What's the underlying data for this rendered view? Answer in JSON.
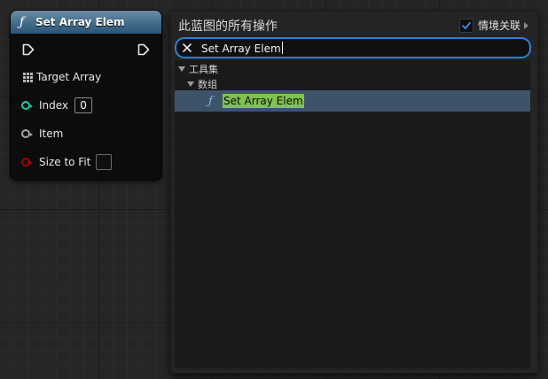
{
  "node": {
    "title": "Set Array Elem",
    "header_icon": "function-icon",
    "pins": {
      "target_array": "Target Array",
      "index": "Index",
      "index_value": "0",
      "item": "Item",
      "size_to_fit": "Size to Fit"
    },
    "colors": {
      "header": "#3f6a89",
      "index_pin": "#1fc9a6",
      "item_pin": "#a8a8a8",
      "size_to_fit_pin": "#a30000"
    }
  },
  "menu": {
    "title": "此蓝图的所有操作",
    "context_sensitive_label": "情境关联",
    "context_sensitive_checked": true,
    "search_value": "Set Array Elem",
    "categories": [
      {
        "label": "工具集"
      },
      {
        "label": "数组"
      }
    ],
    "result": {
      "label": "Set Array Elem",
      "icon": "function-icon"
    },
    "colors": {
      "search_border": "#2f7fd3",
      "selected_row": "#3e536a",
      "match_highlight": "#7fc24f"
    }
  }
}
